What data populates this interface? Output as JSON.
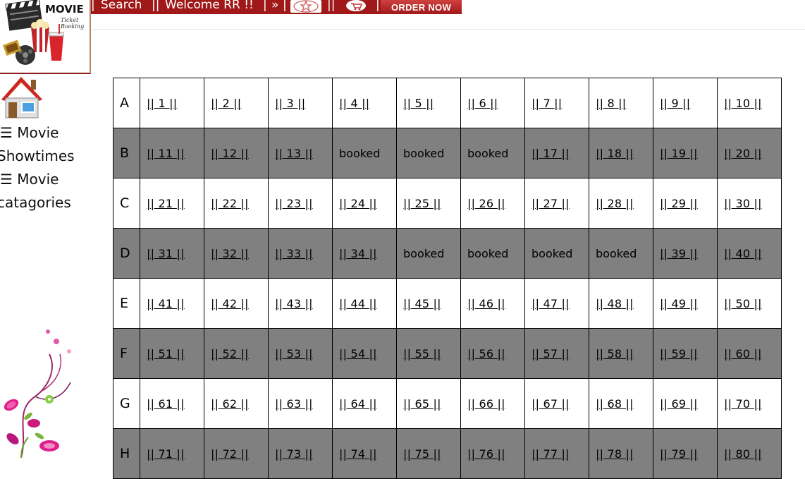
{
  "header": {
    "logo_title": "MOVIE",
    "logo_subtitle": "Ticket Booking",
    "nav_search": "Search",
    "nav_welcome": "Welcome RR !!",
    "nav_arrow": "»",
    "order_now": "ORDER NOW",
    "sep": "|",
    "sep_double": "||"
  },
  "sidebar": {
    "movie_showtimes_line1": "☰ Movie",
    "movie_showtimes_line2": "Showtimes",
    "movie_categories_line1": "☰ Movie",
    "movie_categories_line2": "catagories"
  },
  "seat_link_format": "|| N ||",
  "booked_label": "booked",
  "rows": [
    {
      "label": "A",
      "seats": [
        "|| 1 ||",
        "|| 2 ||",
        "|| 3 ||",
        "|| 4 ||",
        "|| 5 ||",
        "|| 6 ||",
        "|| 7 ||",
        "|| 8 ||",
        "|| 9 ||",
        "|| 10 ||"
      ]
    },
    {
      "label": "B",
      "seats": [
        "|| 11 ||",
        "|| 12 ||",
        "|| 13 ||",
        "booked",
        "booked",
        "booked",
        "|| 17 ||",
        "|| 18 ||",
        "|| 19 ||",
        "|| 20 ||"
      ]
    },
    {
      "label": "C",
      "seats": [
        "|| 21 ||",
        "|| 22 ||",
        "|| 23 ||",
        "|| 24 ||",
        "|| 25 ||",
        "|| 26 ||",
        "|| 27 ||",
        "|| 28 ||",
        "|| 29 ||",
        "|| 30 ||"
      ]
    },
    {
      "label": "D",
      "seats": [
        "|| 31 ||",
        "|| 32 ||",
        "|| 33 ||",
        "|| 34 ||",
        "booked",
        "booked",
        "booked",
        "booked",
        "|| 39 ||",
        "|| 40 ||"
      ]
    },
    {
      "label": "E",
      "seats": [
        "|| 41 ||",
        "|| 42 ||",
        "|| 43 ||",
        "|| 44 ||",
        "|| 45 ||",
        "|| 46 ||",
        "|| 47 ||",
        "|| 48 ||",
        "|| 49 ||",
        "|| 50 ||"
      ]
    },
    {
      "label": "F",
      "seats": [
        "|| 51 ||",
        "|| 52 ||",
        "|| 53 ||",
        "|| 54 ||",
        "|| 55 ||",
        "|| 56 ||",
        "|| 57 ||",
        "|| 58 ||",
        "|| 59 ||",
        "|| 60 ||"
      ]
    },
    {
      "label": "G",
      "seats": [
        "|| 61 ||",
        "|| 62 ||",
        "|| 63 ||",
        "|| 64 ||",
        "|| 65 ||",
        "|| 66 ||",
        "|| 67 ||",
        "|| 68 ||",
        "|| 69 ||",
        "|| 70 ||"
      ]
    },
    {
      "label": "H",
      "seats": [
        "|| 71 ||",
        "|| 72 ||",
        "|| 73 ||",
        "|| 74 ||",
        "|| 75 ||",
        "|| 76 ||",
        "|| 77 ||",
        "|| 78 ||",
        "|| 79 ||",
        "|| 80 ||"
      ]
    }
  ],
  "colors": {
    "nav_red": "#a01818",
    "dark_row": "#808080",
    "light_row": "#ffffff"
  }
}
